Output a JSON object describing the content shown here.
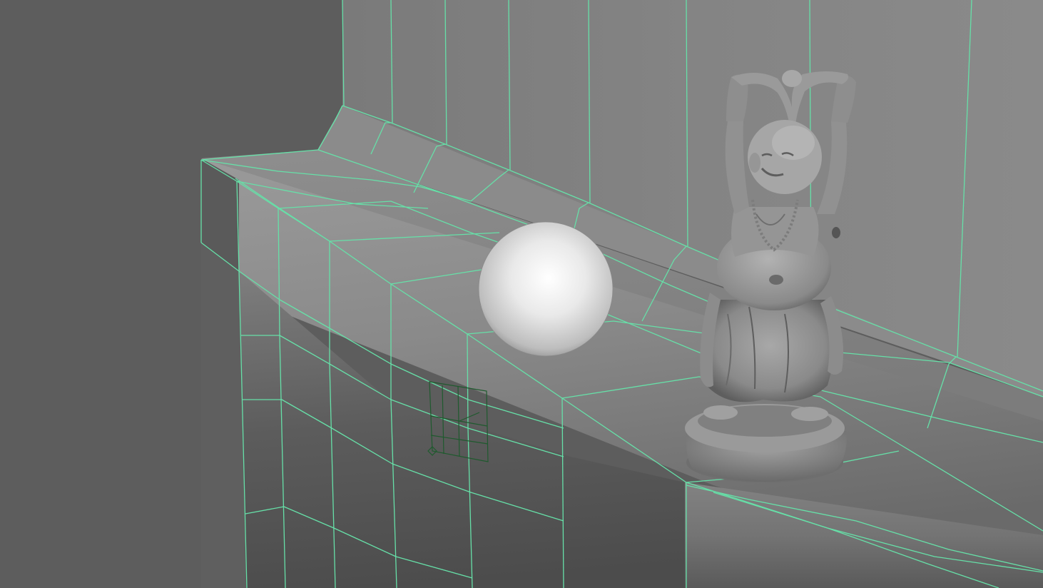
{
  "viewport": {
    "title": "",
    "background": "#5d5d5d",
    "wireframe_color": "#66e0a8",
    "locator_color": "#1f5a2e",
    "objects": [
      {
        "name": "background-wall",
        "type": "polygon-mesh",
        "shading": "smooth-shade-with-wireframe"
      },
      {
        "name": "ledge",
        "type": "polygon-mesh",
        "shading": "smooth-shade-with-wireframe"
      },
      {
        "name": "sphere",
        "type": "nurbs-sphere",
        "shading": "smooth-shade"
      },
      {
        "name": "buddha-statue",
        "type": "polygon-mesh",
        "shading": "smooth-shade"
      },
      {
        "name": "camera-locator",
        "type": "locator"
      }
    ]
  }
}
